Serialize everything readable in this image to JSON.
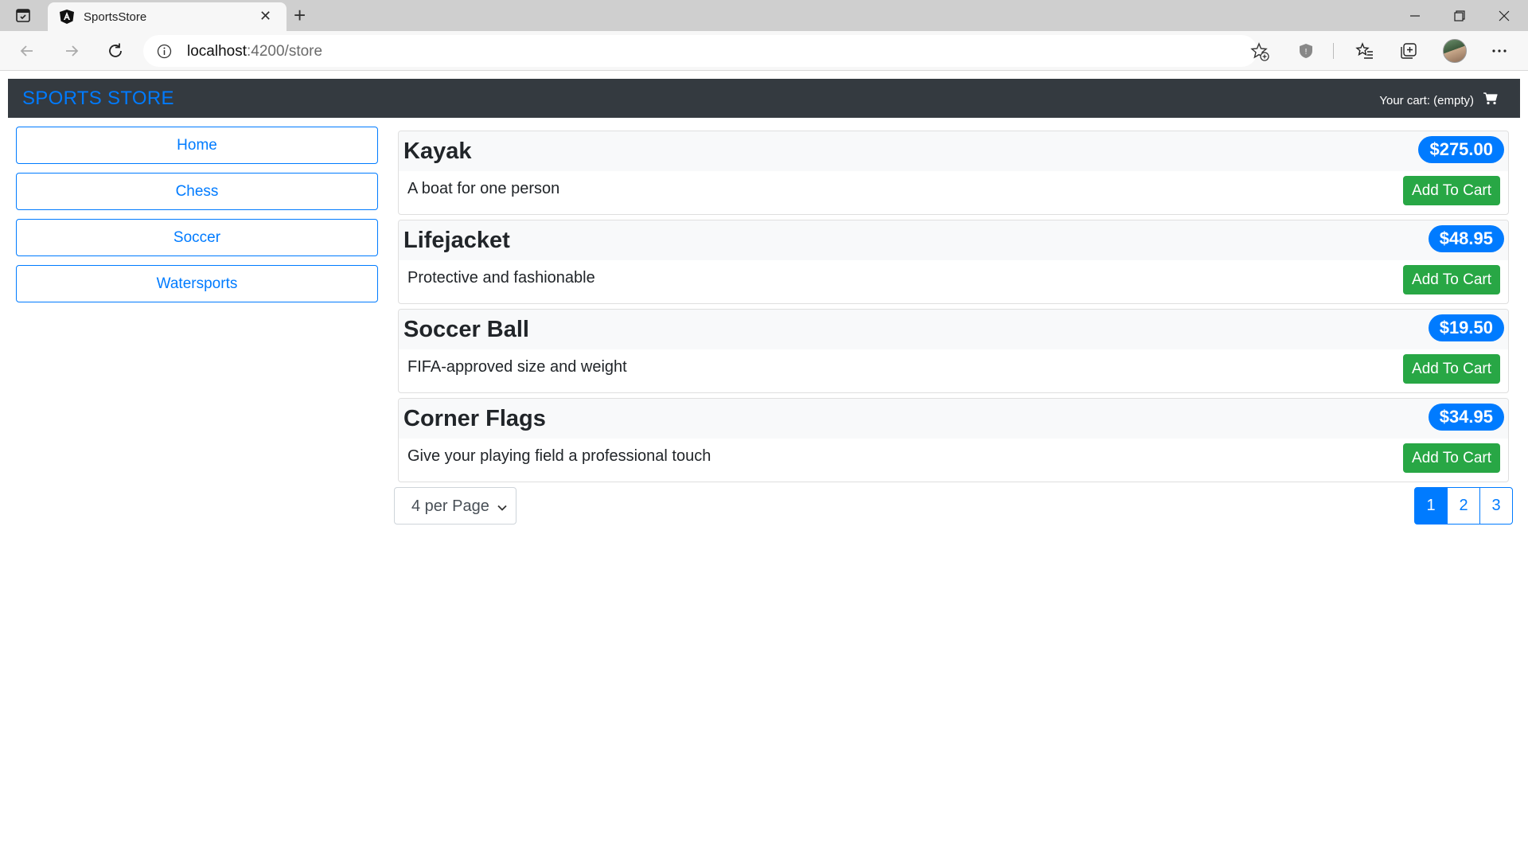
{
  "browser": {
    "tab_title": "SportsStore",
    "url_host": "localhost",
    "url_path": ":4200/store",
    "icons": [
      "tab-actions-icon",
      "angular-favicon",
      "close-tab-icon",
      "new-tab-icon",
      "back-icon",
      "forward-icon",
      "reload-icon",
      "info-icon",
      "add-favorite-icon",
      "shield-icon",
      "favorites-icon",
      "collections-icon",
      "profile-avatar",
      "more-icon"
    ]
  },
  "navbar": {
    "brand": "SPORTS STORE",
    "cart_summary": "Your cart: (empty)",
    "brand_color": "#007bff",
    "background": "#343a40"
  },
  "categories": [
    "Home",
    "Chess",
    "Soccer",
    "Watersports"
  ],
  "products": [
    {
      "name": "Kayak",
      "price": "$275.00",
      "description": "A boat for one person",
      "button": "Add To Cart"
    },
    {
      "name": "Lifejacket",
      "price": "$48.95",
      "description": "Protective and fashionable",
      "button": "Add To Cart"
    },
    {
      "name": "Soccer Ball",
      "price": "$19.50",
      "description": "FIFA-approved size and weight",
      "button": "Add To Cart"
    },
    {
      "name": "Corner Flags",
      "price": "$34.95",
      "description": "Give your playing field a professional touch",
      "button": "Add To Cart"
    }
  ],
  "pagination": {
    "per_page_selected": "4 per Page",
    "pages": [
      "1",
      "2",
      "3"
    ],
    "active_page": "1"
  },
  "colors": {
    "primary": "#007bff",
    "success": "#28a745"
  }
}
